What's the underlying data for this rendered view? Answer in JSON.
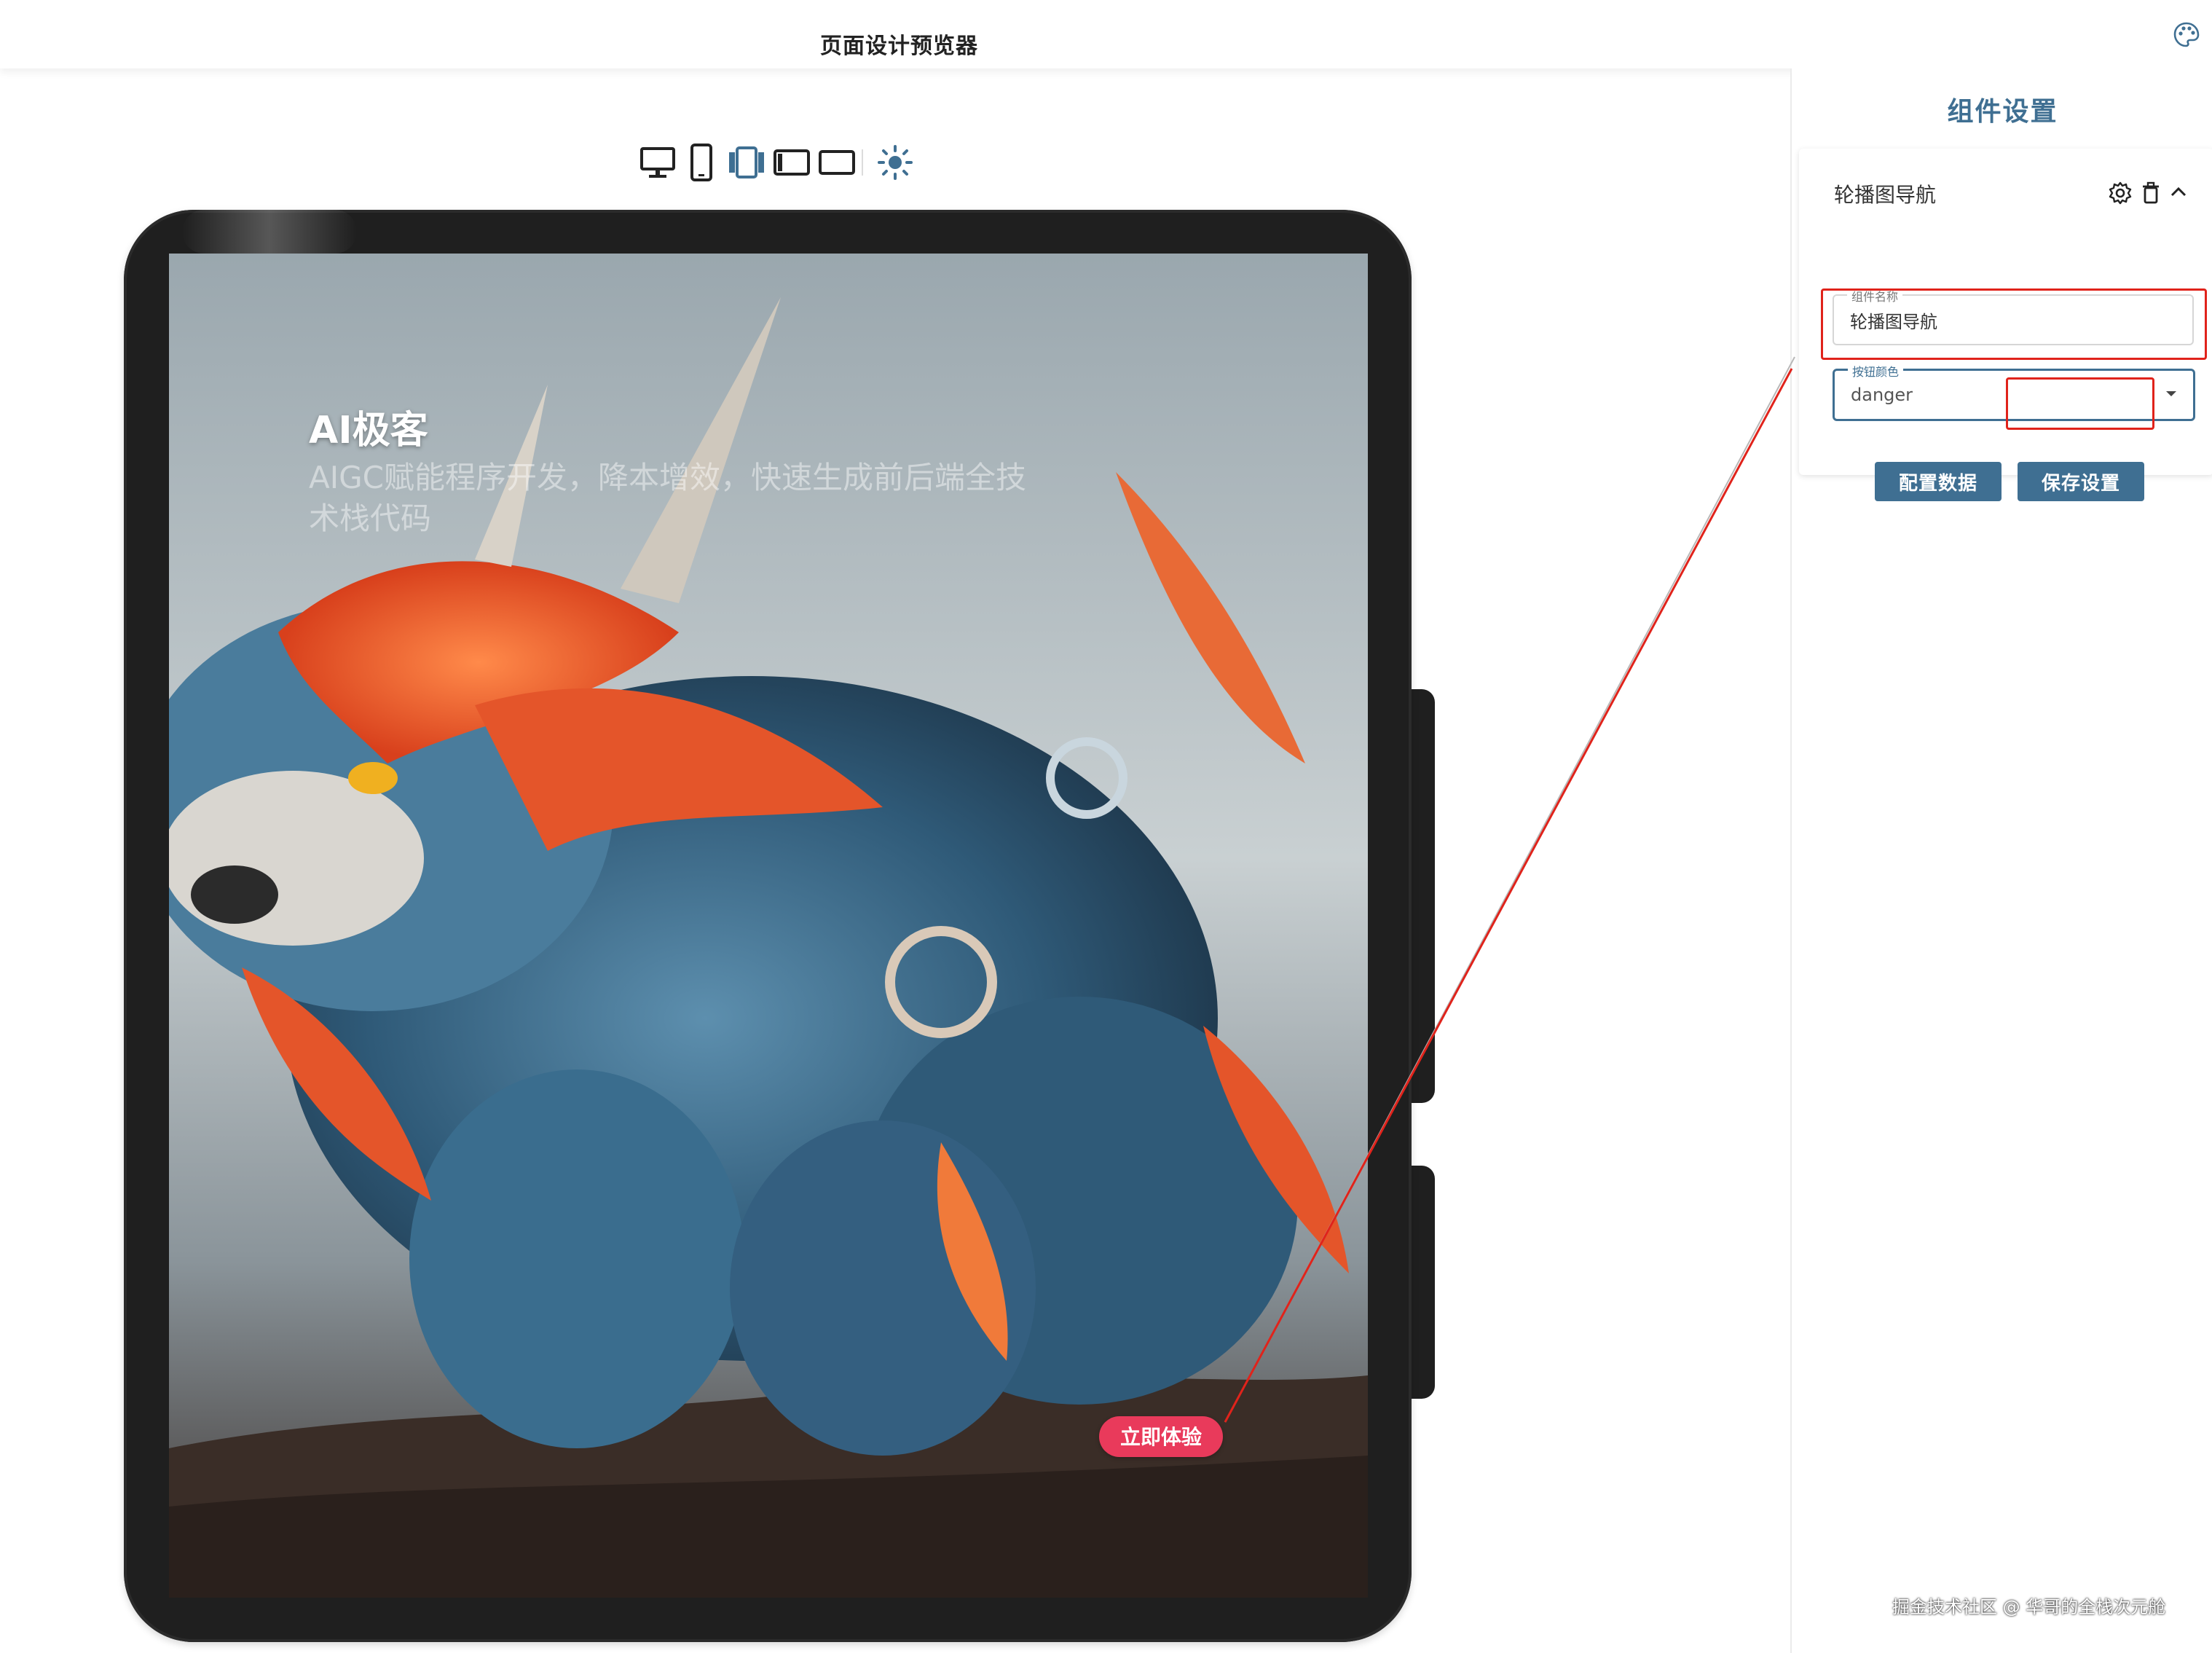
{
  "app": {
    "title": "页面设计预览器",
    "theme_icon": "palette-icon"
  },
  "toolbar": {
    "devices": [
      {
        "name": "desktop",
        "icon": "monitor-icon"
      },
      {
        "name": "phone",
        "icon": "phone-icon"
      },
      {
        "name": "tablet",
        "icon": "tablet-icon",
        "active": true
      },
      {
        "name": "laptop",
        "icon": "laptop-icon"
      },
      {
        "name": "widescreen",
        "icon": "widescreen-icon"
      }
    ],
    "theme_toggle_icon": "sun-icon"
  },
  "preview": {
    "hero": {
      "title": "AI极客",
      "subtitle": "AIGC赋能程序开发，降本增效，快速生成前后端全技术栈代码",
      "button_label": "立即体验",
      "button_color": "#e93a5b"
    }
  },
  "settings": {
    "heading": "组件设置",
    "component": {
      "title": "轮播图导航",
      "icons": [
        "gear-icon",
        "trash-icon",
        "chevron-up-icon"
      ],
      "fields": {
        "name": {
          "label": "组件名称",
          "value": "轮播图导航"
        },
        "button_color": {
          "label": "按钮颜色",
          "value": "danger"
        }
      }
    },
    "buttons": {
      "config_data": "配置数据",
      "save": "保存设置"
    }
  },
  "colors": {
    "accent": "#3f6f92",
    "highlight": "#e0231b",
    "danger": "#e93a5b"
  },
  "watermark": "掘金技术社区 @ 华哥的全栈次元舱"
}
